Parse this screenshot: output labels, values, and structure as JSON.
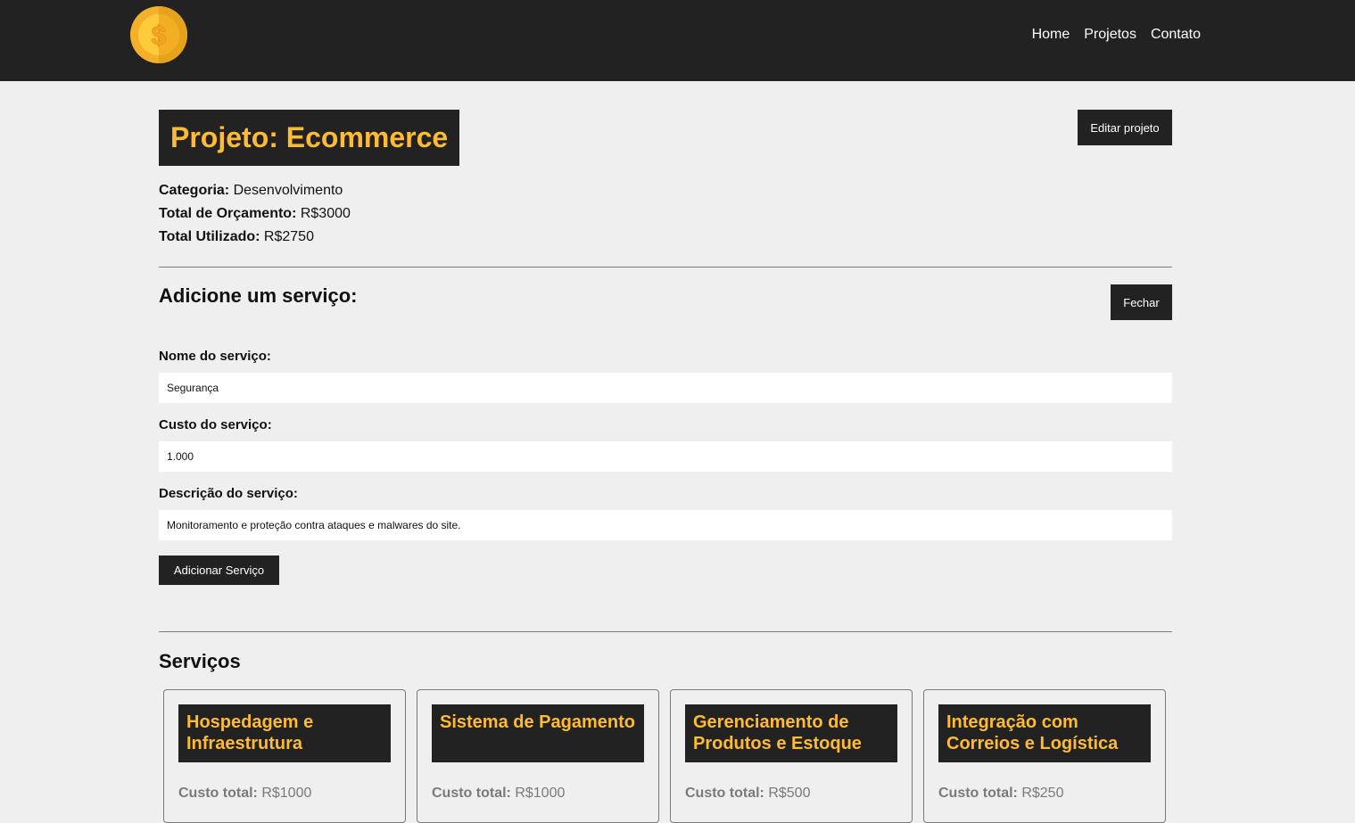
{
  "nav": {
    "links": [
      "Home",
      "Projetos",
      "Contato"
    ]
  },
  "logo": {
    "icon": "coin-dollar-icon",
    "colors": [
      "#f5b02b",
      "#ffcb3b",
      "#e7a21b"
    ]
  },
  "project": {
    "title": "Projeto: Ecommerce",
    "edit_label": "Editar projeto",
    "category_label": "Categoria:",
    "category_value": "Desenvolvimento",
    "budget_label": "Total de Orçamento:",
    "budget_value": "R$3000",
    "used_label": "Total Utilizado:",
    "used_value": "R$2750"
  },
  "add_service": {
    "title": "Adicione um serviço:",
    "close_label": "Fechar",
    "name_label": "Nome do serviço:",
    "name_value": "Segurança",
    "cost_label": "Custo do serviço:",
    "cost_value": "1.000",
    "description_label": "Descrição do serviço:",
    "description_value": "Monitoramento e proteção contra ataques e malwares do site.",
    "submit_label": "Adicionar Serviço"
  },
  "services": {
    "title": "Serviços",
    "cost_label": "Custo total:",
    "items": [
      {
        "name": "Hospedagem e Infraestrutura",
        "cost": "R$1000"
      },
      {
        "name": "Sistema de Pagamento",
        "cost": "R$1000"
      },
      {
        "name": "Gerenciamento de Produtos e Estoque",
        "cost": "R$500"
      },
      {
        "name": "Integração com Correios e Logística",
        "cost": "R$250"
      }
    ]
  },
  "colors": {
    "dark": "#222222",
    "accent": "#ffbb33",
    "background": "#efefef"
  }
}
